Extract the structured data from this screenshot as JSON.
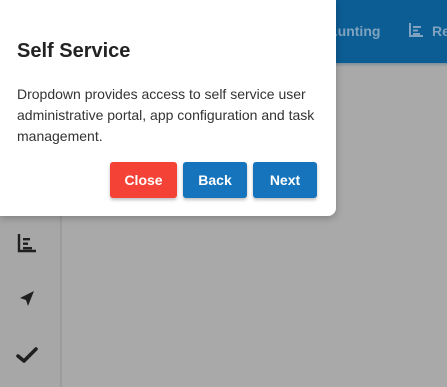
{
  "header": {
    "nav_items": [
      {
        "label": "...unting",
        "icon": "dollar-icon"
      },
      {
        "label": "Re",
        "icon": "bar-chart-icon"
      }
    ]
  },
  "sidebar": {
    "icons": [
      "bar-chart-icon",
      "navigation-arrow-icon",
      "checkmark-icon"
    ]
  },
  "tour_popover": {
    "title": "Self Service",
    "body": "Dropdown provides access to self service user administrative portal, app configuration and task management.",
    "close_label": "Close",
    "back_label": "Back",
    "next_label": "Next"
  },
  "colors": {
    "header_bg": "#0b5d94",
    "overlay_bg": "#a9a9a9",
    "close_button": "#f44336",
    "primary_button": "#1574bc"
  }
}
